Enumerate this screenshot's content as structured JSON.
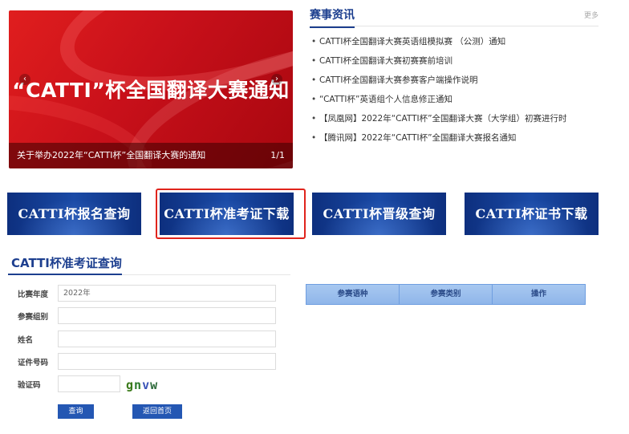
{
  "banner": {
    "title": "“CATTI”杯全国翻译大赛通知",
    "caption": "关于举办2022年“CATTI杯”全国翻译大赛的通知",
    "page_indicator": "1/1",
    "prev_glyph": "‹",
    "next_glyph": "›"
  },
  "news": {
    "title": "赛事资讯",
    "more": "更多",
    "items": [
      "CATTI杯全国翻译大赛英语组模拟赛 （公测）通知",
      "CATTI杯全国翻译大赛初赛赛前培训",
      "CATTI杯全国翻译大赛参赛客户端操作说明",
      "“CATTI杯”英语组个人信息修正通知",
      "【凤凰网】2022年“CATTI杯”全国翻译大赛（大学组）初赛进行时",
      "【腾讯网】2022年“CATTI杯”全国翻译大赛报名通知"
    ]
  },
  "nav_buttons": [
    {
      "label": "CATTI杯报名查询"
    },
    {
      "label": "CATTI杯准考证下载"
    },
    {
      "label": "CATTI杯晋级查询"
    },
    {
      "label": "CATTI杯证书下载"
    }
  ],
  "form": {
    "title": "CATTI杯准考证查询",
    "year_label": "比赛年度",
    "year_value": "2022年",
    "group_label": "参赛组别",
    "group_value": "",
    "name_label": "姓名",
    "name_value": "",
    "id_label": "证件号码",
    "id_value": "",
    "captcha_label": "验证码",
    "captcha_value": "",
    "captcha_chars": [
      "g",
      "n",
      "v",
      "w"
    ],
    "query_button": "查询",
    "home_button": "返回首页"
  },
  "table": {
    "headers": [
      "参赛语种",
      "参赛类别",
      "操作"
    ]
  },
  "colors": {
    "brand_blue": "#1d3f8f",
    "banner_red": "#c8101a",
    "highlight_red": "#e0241c",
    "button_blue": "#2457b3"
  },
  "icons": {
    "prev": "chevron-left-icon",
    "next": "chevron-right-icon"
  }
}
